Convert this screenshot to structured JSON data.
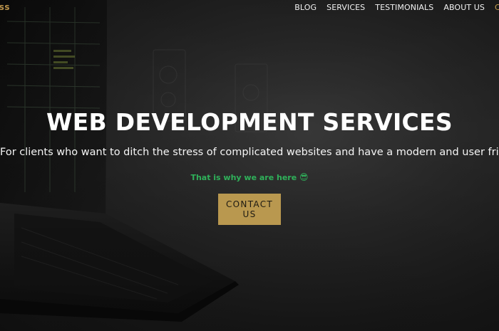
{
  "brand": {
    "text_visible": "ss",
    "color": "#b9924b"
  },
  "nav": {
    "items": [
      {
        "label": "BLOG"
      },
      {
        "label": "SERVICES"
      },
      {
        "label": "TESTIMONIALS"
      },
      {
        "label": "ABOUT US"
      }
    ],
    "truncated_item": "C"
  },
  "hero": {
    "title": "WEB DEVELOPMENT SERVICES",
    "subtitle": "For clients who want to ditch the stress of complicated websites and have a modern and user friendly site.",
    "tagline": "That is why we are here",
    "tagline_emoji": "😎",
    "cta_label": "CONTACT US"
  },
  "colors": {
    "accent": "#b9984f",
    "tagline": "#2fb15a",
    "background": "#1b1b1b"
  },
  "icons": {
    "hero_image": "laptop-illustration"
  }
}
